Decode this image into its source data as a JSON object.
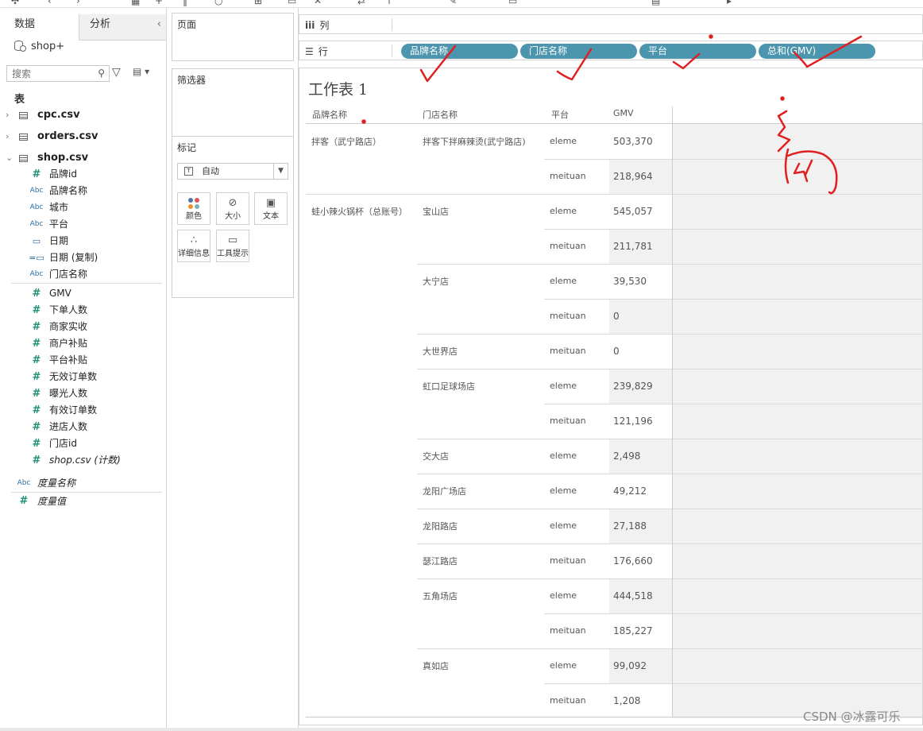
{
  "left_pane": {
    "tabs": [
      "数据",
      "分析"
    ],
    "datasource": "shop+",
    "search": {
      "placeholder": "搜索"
    },
    "section_label": "表",
    "tables": [
      "cpc.csv",
      "orders.csv",
      "shop.csv"
    ],
    "fields": [
      {
        "type": "#",
        "label": "品牌id"
      },
      {
        "type": "Abc",
        "label": "品牌名称"
      },
      {
        "type": "Abc",
        "label": "城市"
      },
      {
        "type": "Abc",
        "label": "平台"
      },
      {
        "type": "date",
        "label": "日期"
      },
      {
        "type": "date",
        "label": "日期 (复制)"
      },
      {
        "type": "Abc",
        "label": "门店名称"
      },
      {
        "type": "#",
        "label": "GMV"
      },
      {
        "type": "#",
        "label": "下单人数"
      },
      {
        "type": "#",
        "label": "商家实收"
      },
      {
        "type": "#",
        "label": "商户补贴"
      },
      {
        "type": "#",
        "label": "平台补贴"
      },
      {
        "type": "#",
        "label": "无效订单数"
      },
      {
        "type": "#",
        "label": "曝光人数"
      },
      {
        "type": "#",
        "label": "有效订单数"
      },
      {
        "type": "#",
        "label": "进店人数"
      },
      {
        "type": "#",
        "label": "门店id"
      },
      {
        "type": "#",
        "label": "shop.csv (计数)"
      }
    ],
    "measures": [
      {
        "type": "Abc",
        "label": "度量名称"
      },
      {
        "type": "#",
        "label": "度量值"
      }
    ]
  },
  "mid_pane": {
    "pages_title": "页面",
    "filters_title": "筛选器",
    "marks_title": "标记",
    "mark_type": "自动",
    "mark_buttons": [
      "颜色",
      "大小",
      "文本",
      "详细信息",
      "工具提示"
    ]
  },
  "shelves": {
    "columns_label": "列",
    "rows_label": "行",
    "row_pills": [
      "品牌名称",
      "门店名称",
      "平台",
      "总和(GMV)"
    ]
  },
  "worksheet": {
    "title": "工作表 1",
    "headers": [
      "品牌名称",
      "门店名称",
      "平台",
      "GMV"
    ],
    "brands": [
      "拌客（武宁路店）",
      "蛙小辣火锅杯（总账号）"
    ],
    "rows": [
      {
        "store": "拌客下拌麻辣烫(武宁路店)",
        "platform": "eleme",
        "gmv": "503,370"
      },
      {
        "store": "",
        "platform": "meituan",
        "gmv": "218,964"
      },
      {
        "store": "宝山店",
        "platform": "eleme",
        "gmv": "545,057"
      },
      {
        "store": "",
        "platform": "meituan",
        "gmv": "211,781"
      },
      {
        "store": "大宁店",
        "platform": "eleme",
        "gmv": "39,530"
      },
      {
        "store": "",
        "platform": "meituan",
        "gmv": "0"
      },
      {
        "store": "大世界店",
        "platform": "meituan",
        "gmv": "0"
      },
      {
        "store": "虹口足球场店",
        "platform": "eleme",
        "gmv": "239,829"
      },
      {
        "store": "",
        "platform": "meituan",
        "gmv": "121,196"
      },
      {
        "store": "交大店",
        "platform": "eleme",
        "gmv": "2,498"
      },
      {
        "store": "龙阳广场店",
        "platform": "eleme",
        "gmv": "49,212"
      },
      {
        "store": "龙阳路店",
        "platform": "eleme",
        "gmv": "27,188"
      },
      {
        "store": "瑟江路店",
        "platform": "meituan",
        "gmv": "176,660"
      },
      {
        "store": "五角场店",
        "platform": "eleme",
        "gmv": "444,518"
      },
      {
        "store": "",
        "platform": "meituan",
        "gmv": "185,227"
      },
      {
        "store": "真如店",
        "platform": "eleme",
        "gmv": "99,092"
      },
      {
        "store": "",
        "platform": "meituan",
        "gmv": "1,208"
      }
    ]
  },
  "watermark": "CSDN @冰露可乐",
  "colors": {
    "pill": "#4c95ae",
    "annotation": "#e02020",
    "number_icon": "#1f8f75",
    "abc_icon": "#2a6ea6"
  }
}
